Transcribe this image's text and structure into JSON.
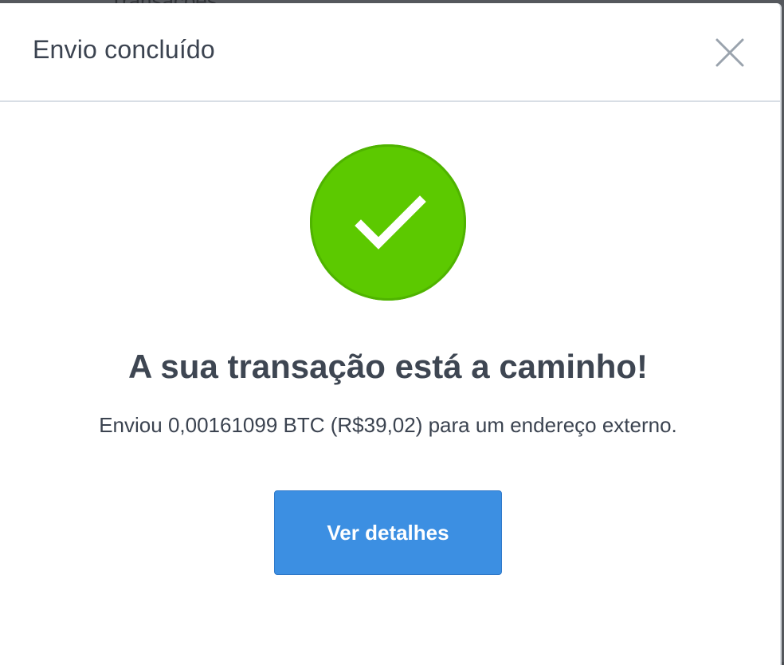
{
  "background": {
    "partial_text": "Transações"
  },
  "modal": {
    "title": "Envio concluído",
    "close_icon": "close-icon",
    "success_icon": "checkmark-icon",
    "headline": "A sua transação está a caminho!",
    "message": "Enviou 0,00161099 BTC (R$39,02) para um endereço externo.",
    "details_button_label": "Ver detalhes"
  },
  "colors": {
    "success": "#5cc900",
    "primary_button": "#3c8fe2",
    "text": "#3b4350"
  }
}
